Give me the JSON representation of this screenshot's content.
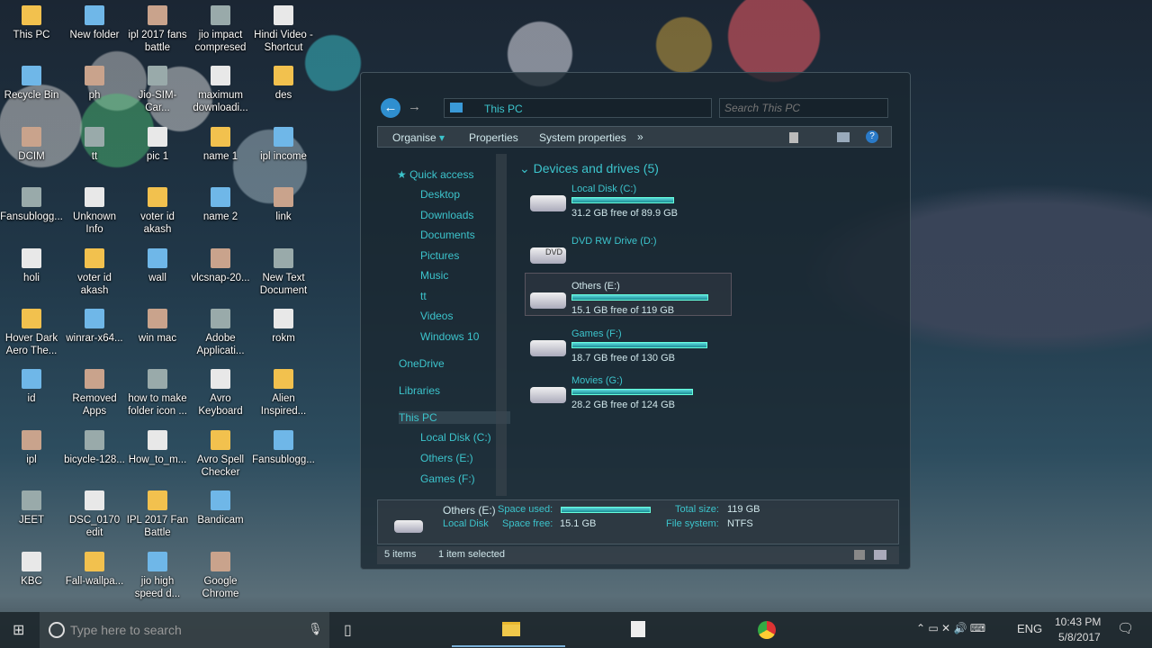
{
  "desktop": {
    "columns": [
      [
        "This PC",
        "Recycle Bin",
        "DCIM",
        "Fansublogg...",
        "holi",
        "Hover Dark Aero The...",
        "id",
        "ipl",
        "JEET",
        "KBC"
      ],
      [
        "New folder",
        "ph",
        "tt",
        "Unknown Info",
        "voter id akash",
        "winrar-x64...",
        "Removed Apps",
        "bicycle-128...",
        "DSC_0170 edit",
        "Fall-wallpa..."
      ],
      [
        "ipl 2017 fans battle",
        "Jio-SIM-Car...",
        "pic 1",
        "voter id akash",
        "wall",
        "win mac",
        "how to make folder icon ...",
        "How_to_m...",
        "IPL 2017 Fan Battle",
        "jio high speed d..."
      ],
      [
        "jio impact compresed",
        "maximum downloadi...",
        "name 1",
        "name 2",
        "vlcsnap-20...",
        "Adobe Applicati...",
        "Avro Keyboard",
        "Avro Spell Checker",
        "Bandicam",
        "Google Chrome"
      ],
      [
        "Hindi Video - Shortcut",
        "des",
        "ipl income",
        "link",
        "New Text Document",
        "rokm",
        "Alien Inspired...",
        "Fansublogg..."
      ]
    ]
  },
  "explorer": {
    "address": "This PC",
    "search_placeholder": "Search This PC",
    "toolbar": {
      "organise": "Organise",
      "properties": "Properties",
      "system_properties": "System properties",
      "more": "»"
    },
    "sidebar": {
      "quick_access": "Quick access",
      "items": [
        "Desktop",
        "Downloads",
        "Documents",
        "Pictures",
        "Music",
        "tt",
        "Videos",
        "Windows 10"
      ],
      "onedrive": "OneDrive",
      "libraries": "Libraries",
      "this_pc": "This PC",
      "drives": [
        "Local Disk (C:)",
        "Others (E:)",
        "Games (F:)"
      ]
    },
    "group_title": "Devices and drives (5)",
    "drives": [
      {
        "name": "Local Disk (C:)",
        "info": "31.2 GB free of 89.9 GB",
        "used_pct": 65
      },
      {
        "name": "DVD RW Drive (D:)",
        "info": "",
        "label": "DVD"
      },
      {
        "name": "Others (E:)",
        "info": "15.1 GB free of 119 GB",
        "used_pct": 87
      },
      {
        "name": "Games (F:)",
        "info": "18.7 GB free of 130 GB",
        "used_pct": 86
      },
      {
        "name": "Movies (G:)",
        "info": "28.2 GB free of 124 GB",
        "used_pct": 77
      }
    ],
    "details": {
      "name": "Others (E:)",
      "type": "Local Disk",
      "space_used_label": "Space used:",
      "space_free_label": "Space free:",
      "space_free": "15.1 GB",
      "total_size_label": "Total size:",
      "total_size": "119 GB",
      "fs_label": "File system:",
      "fs": "NTFS",
      "used_pct": 87
    },
    "status": {
      "items": "5 items",
      "selected": "1 item selected"
    }
  },
  "taskbar": {
    "search_placeholder": "Type here to search",
    "lang": "ENG",
    "time": "10:43 PM",
    "date": "5/8/2017"
  },
  "colors": {
    "accent": "#3cc4cc"
  }
}
